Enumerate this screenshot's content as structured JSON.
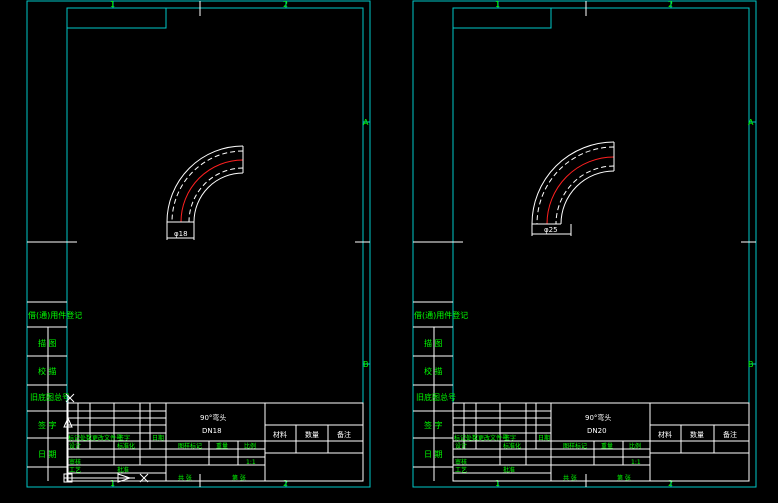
{
  "colors": {
    "background": "#000000",
    "frame": "#00c8c8",
    "lines": "#ffffff",
    "text_green": "#00ff00",
    "centerline": "#ff2020"
  },
  "sheets": [
    {
      "grid_top": [
        "1",
        "2"
      ],
      "grid_bottom": [
        "1",
        "2"
      ],
      "grid_right": [
        "A",
        "B"
      ],
      "side_labels": [
        "借(通)用件登记",
        "描 图",
        "校 描",
        "旧底图总号",
        "签 字",
        "日 期"
      ],
      "dimension": "φ18",
      "title_line1": "90°弯头",
      "title_line2": "DN18",
      "stage_label": "图样标记",
      "weight_label": "重量",
      "scale_label": "比例",
      "scale_value": "1:1",
      "sheet_count": "共 张",
      "sheet_no": "第 张",
      "material_header": [
        "材料",
        "数量",
        "备注"
      ],
      "rev_headers": [
        "标记",
        "处数",
        "更改文件号",
        "签字",
        "日期"
      ],
      "roles": [
        "设计",
        "审核",
        "工艺"
      ],
      "std_label": "标准化",
      "approve_label": "批准"
    },
    {
      "grid_top": [
        "1",
        "2"
      ],
      "grid_bottom": [
        "1",
        "2"
      ],
      "grid_right": [
        "A",
        "B"
      ],
      "side_labels": [
        "借(通)用件登记",
        "描 图",
        "校 描",
        "旧底图总号",
        "签 字",
        "日 期"
      ],
      "dimension": "φ25",
      "title_line1": "90°弯头",
      "title_line2": "DN20",
      "stage_label": "图样标记",
      "weight_label": "重量",
      "scale_label": "比例",
      "scale_value": "1:1",
      "sheet_count": "共 张",
      "sheet_no": "第 张",
      "material_header": [
        "材料",
        "数量",
        "备注"
      ],
      "rev_headers": [
        "标记",
        "处数",
        "更改文件号",
        "签字",
        "日期"
      ],
      "roles": [
        "设计",
        "审核",
        "工艺"
      ],
      "std_label": "标准化",
      "approve_label": "批准"
    }
  ]
}
